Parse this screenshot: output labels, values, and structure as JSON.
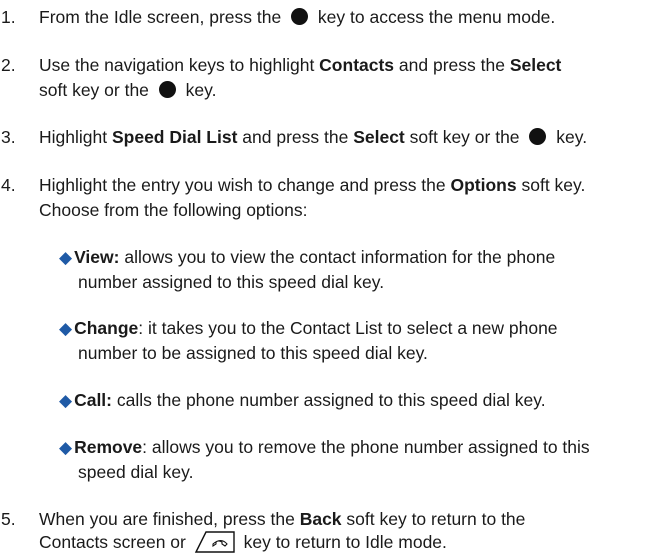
{
  "steps": [
    {
      "num": "1.",
      "lines": [
        [
          "From the Idle screen, press the ",
          "{dot}",
          " key to access the menu mode."
        ]
      ]
    },
    {
      "num": "2.",
      "lines": [
        [
          "Use the navigation keys to highlight ",
          "{b}Contacts",
          " and press the ",
          "{b}Select"
        ],
        [
          "soft key or the ",
          "{dot}",
          " key."
        ]
      ]
    },
    {
      "num": "3.",
      "lines": [
        [
          "Highlight ",
          "{b}Speed Dial List",
          " and press the ",
          "{b}Select",
          " soft key or the ",
          "{dot}",
          " key."
        ]
      ]
    },
    {
      "num": "4.",
      "lines": [
        [
          "Highlight the entry you wish to change and press the ",
          "{b}Options",
          " soft key."
        ],
        [
          "Choose from the following options:"
        ]
      ]
    },
    {
      "num": "5.",
      "lines": [
        [
          "When you are finished, press the ",
          "{b}Back",
          " soft key to return to the"
        ],
        [
          "Contacts screen or ",
          "{end}",
          " key to return to Idle mode."
        ]
      ]
    }
  ],
  "options": [
    {
      "lines": [
        [
          "{b}View:",
          " allows you to view the contact information for the phone"
        ],
        [
          "number assigned to this speed dial key."
        ]
      ]
    },
    {
      "lines": [
        [
          "{b}Change",
          ": it takes you to the Contact List to select a new phone"
        ],
        [
          "number to be assigned to this speed dial key."
        ]
      ]
    },
    {
      "lines": [
        [
          "{b}Call:",
          " calls the phone number assigned to this speed dial key."
        ]
      ]
    },
    {
      "lines": [
        [
          "{b}Remove",
          ": allows you to remove the phone number assigned to this"
        ],
        [
          "speed dial key."
        ]
      ]
    }
  ],
  "icons": {
    "select_key": "filled-circle-key-icon",
    "end_key": "end-call-key-icon",
    "bullet": "diamond-bullet-icon"
  },
  "colors": {
    "bullet": "#1f5aa6",
    "text": "#1a1a1a"
  }
}
